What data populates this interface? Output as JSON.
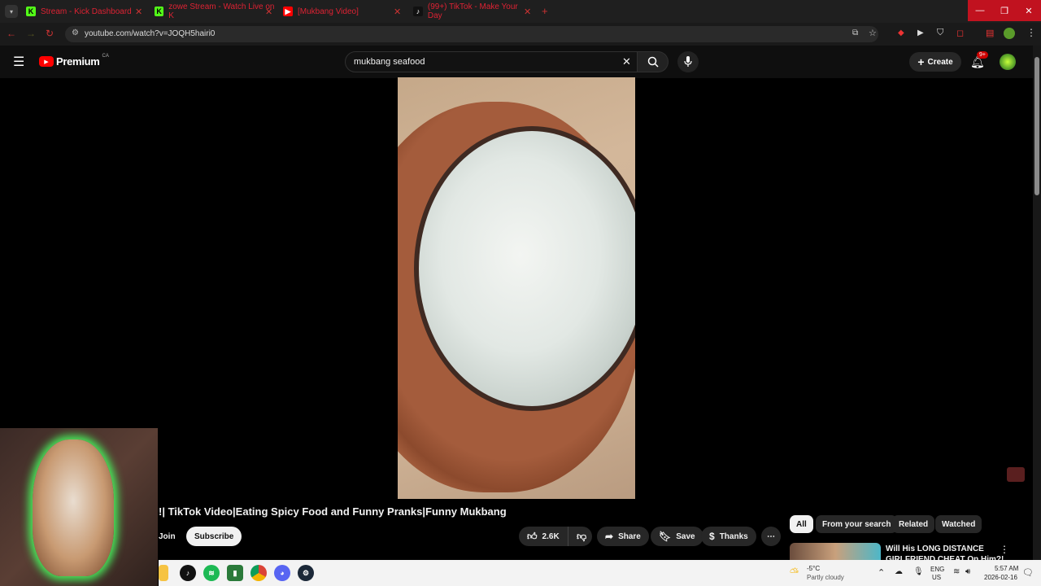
{
  "browser": {
    "tabs": [
      {
        "label": "Stream - Kick Dashboard"
      },
      {
        "label": "zowe Stream - Watch Live on K"
      },
      {
        "label": "[Mukbang Video]"
      },
      {
        "label": "(99+) TikTok - Make Your Day"
      }
    ],
    "url": "youtube.com/watch?v=JOQH5hairi0"
  },
  "youtube": {
    "logo_text": "Premium",
    "region": "CA",
    "search_value": "mukbang seafood",
    "create_label": "Create",
    "notifications_badge": "9+"
  },
  "video": {
    "title": "!| TikTok Video|Eating Spicy Food and Funny Pranks|Funny Mukbang",
    "join_label": "Join",
    "subscribe_label": "Subscribe",
    "likes": "2.6K",
    "share_label": "Share",
    "save_label": "Save",
    "thanks_label": "Thanks"
  },
  "filters": {
    "chips": [
      "All",
      "From your search",
      "Related",
      "Watched"
    ]
  },
  "related": {
    "first_title_line1": "Will His LONG DISTANCE",
    "first_title_line2": "GIRLFRIEND CHEAT On Him?!"
  },
  "taskbar": {
    "weather_temp": "-5°C",
    "weather_desc": "Partly cloudy",
    "lang1": "ENG",
    "lang2": "US",
    "time": "5:57 AM",
    "date": "2026-02-16"
  }
}
